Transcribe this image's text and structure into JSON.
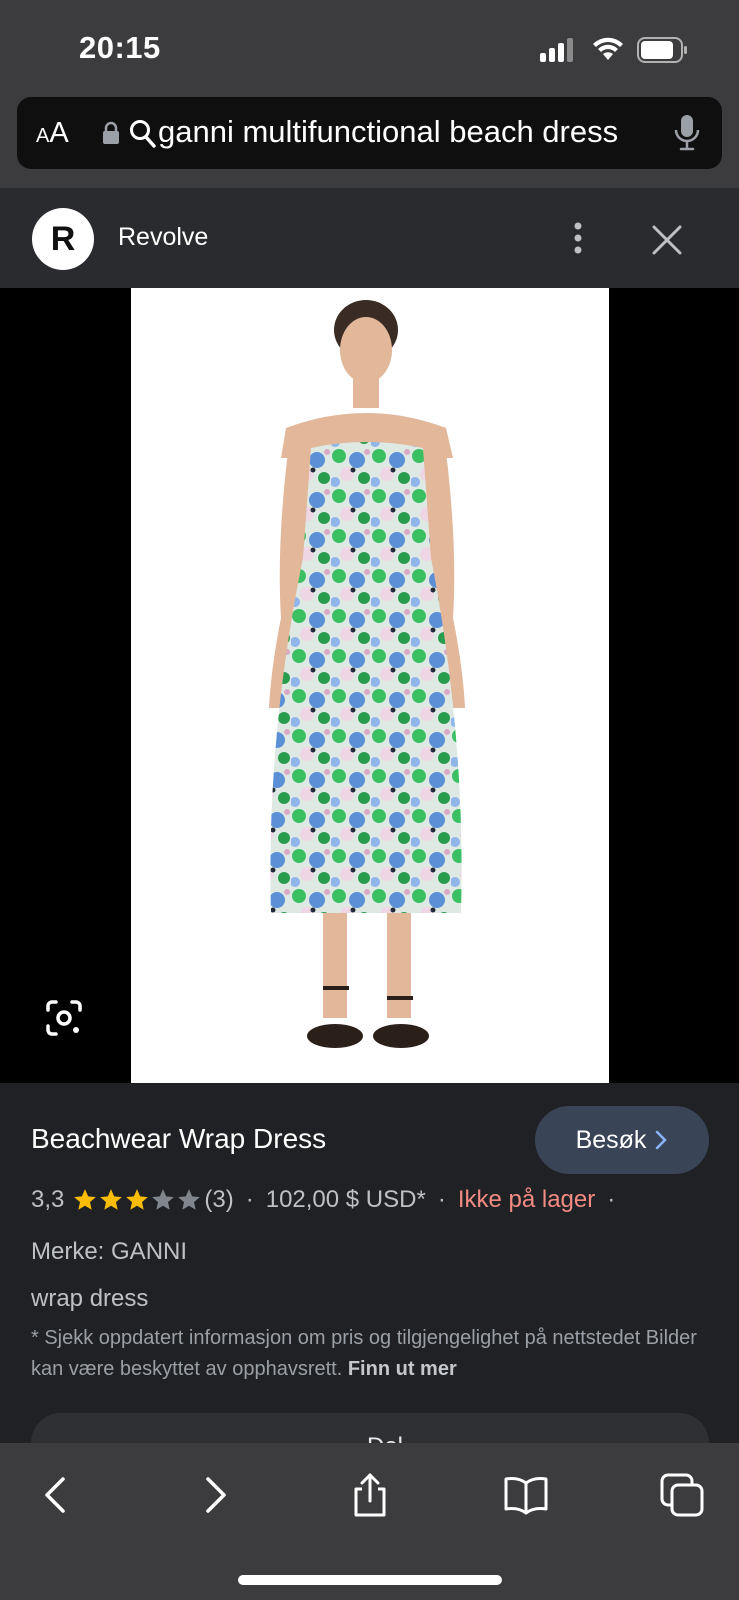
{
  "status_bar": {
    "time": "20:15"
  },
  "url_bar": {
    "text_size_label_small": "A",
    "text_size_label_big": "A",
    "query": "ganni multifunctional beach dress"
  },
  "source": {
    "logo_letter": "R",
    "name": "Revolve"
  },
  "product": {
    "title": "Beachwear Wrap Dress",
    "visit_label": "Besøk",
    "rating": "3,3",
    "stars": 3,
    "review_count": "(3)",
    "price": "102,00 $ USD*",
    "stock_status": "Ikke på lager",
    "separator": "·",
    "brand": "Merke: GANNI",
    "type": "wrap dress",
    "disclaimer": "* Sjekk oppdatert informasjon om pris og tilgjengelighet på nettstedet Bilder kan være beskyttet av opphavsrett.",
    "learn_more": "Finn ut mer",
    "share_label": "Del"
  },
  "colors": {
    "accent_button": "#394457",
    "out_of_stock": "#f28b82",
    "star": "#fbbc04"
  },
  "icons": [
    "lock-icon",
    "search-icon",
    "mic-icon",
    "more-vert-icon",
    "close-icon",
    "lens-icon",
    "back-icon",
    "forward-icon",
    "share-icon",
    "bookmarks-icon",
    "tabs-icon"
  ]
}
